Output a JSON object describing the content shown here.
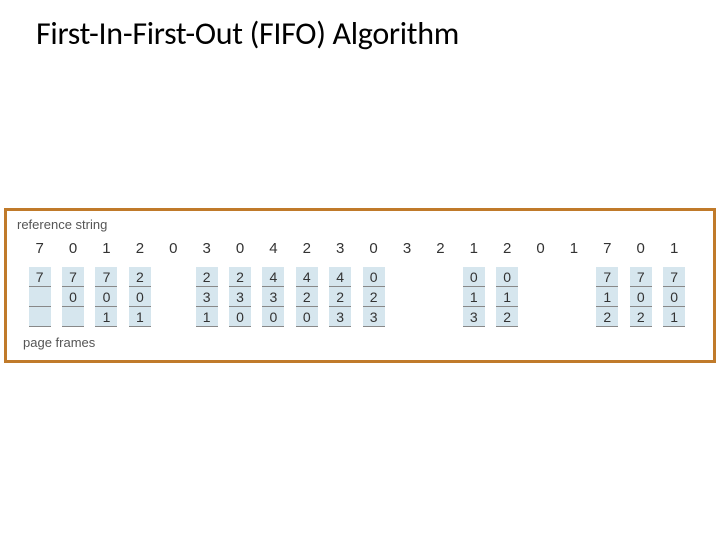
{
  "title": "First-In-First-Out (FIFO) Algorithm",
  "caption_top": "reference string",
  "caption_bottom": "page frames",
  "chart_data": {
    "type": "table",
    "title": "FIFO page replacement trace",
    "reference_string": [
      "7",
      "0",
      "1",
      "2",
      "0",
      "3",
      "0",
      "4",
      "2",
      "3",
      "0",
      "3",
      "2",
      "1",
      "2",
      "0",
      "1",
      "7",
      "0",
      "1"
    ],
    "frames": [
      [
        "7",
        "",
        "",
        ""
      ],
      [
        "7",
        "0",
        "",
        ""
      ],
      [
        "7",
        "0",
        "1",
        ""
      ],
      [
        "2",
        "0",
        "1",
        ""
      ],
      [
        "",
        "",
        "",
        ""
      ],
      [
        "2",
        "3",
        "1",
        ""
      ],
      [
        "2",
        "3",
        "0",
        ""
      ],
      [
        "4",
        "3",
        "0",
        ""
      ],
      [
        "4",
        "2",
        "0",
        ""
      ],
      [
        "4",
        "2",
        "3",
        ""
      ],
      [
        "0",
        "2",
        "3",
        ""
      ],
      [
        "",
        "",
        "",
        ""
      ],
      [
        "",
        "",
        "",
        ""
      ],
      [
        "0",
        "1",
        "3",
        ""
      ],
      [
        "0",
        "1",
        "2",
        ""
      ],
      [
        "",
        "",
        "",
        ""
      ],
      [
        "",
        "",
        "",
        ""
      ],
      [
        "7",
        "1",
        "2",
        ""
      ],
      [
        "7",
        "0",
        "2",
        ""
      ],
      [
        "7",
        "0",
        "1",
        ""
      ]
    ],
    "frame_count": 3
  }
}
